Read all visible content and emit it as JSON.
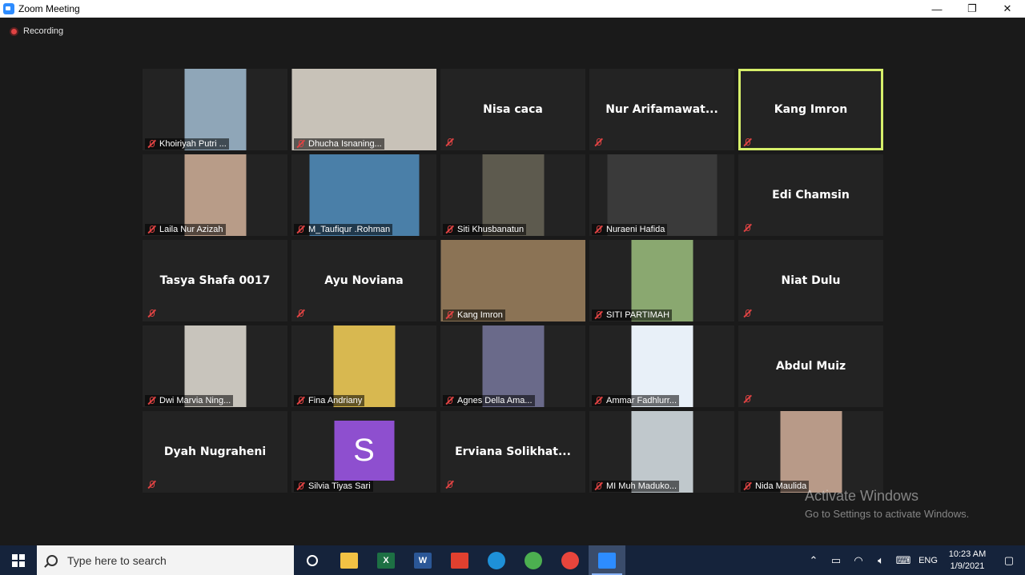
{
  "window": {
    "title": "Zoom Meeting",
    "minimize": "—",
    "maximize": "❐",
    "close": "✕"
  },
  "recording": {
    "label": "Recording"
  },
  "participants": [
    {
      "name": "Khoiriyah Putri ...",
      "video": true,
      "bg": "#8fa6b8"
    },
    {
      "name": "Dhucha Isnaning...",
      "video": true,
      "bg": "#c8c2b8",
      "wide": true
    },
    {
      "name": "Nisa caca",
      "video": false
    },
    {
      "name": "Nur  Arifamawat...",
      "video": false
    },
    {
      "name": "Kang Imron",
      "video": false,
      "active": true
    },
    {
      "name": "Laila Nur Azizah",
      "video": true,
      "bg": "#b89c88"
    },
    {
      "name": "M_Taufiqur .Rohman",
      "video": true,
      "bg": "#4a7fa8",
      "mid": true
    },
    {
      "name": "Siti Khusbanatun",
      "video": true,
      "bg": "#5d5a4e"
    },
    {
      "name": "Nuraeni Hafida",
      "video": true,
      "bg": "#3a3a3a",
      "mid": true
    },
    {
      "name": "Edi Chamsin",
      "video": false
    },
    {
      "name": "Tasya Shafa 0017",
      "video": false
    },
    {
      "name": "Ayu Noviana",
      "video": false
    },
    {
      "name": "Kang Imron",
      "video": true,
      "bg": "#8b7355",
      "wide": true
    },
    {
      "name": "SITI PARTIMAH",
      "video": true,
      "bg": "#8aa870"
    },
    {
      "name": "Niat Dulu",
      "video": false
    },
    {
      "name": "Dwi Marvia Ning...",
      "video": true,
      "bg": "#c8c4bc"
    },
    {
      "name": "Fina Andriany",
      "video": true,
      "bg": "#d8b850"
    },
    {
      "name": "Agnes Della Ama...",
      "video": true,
      "bg": "#6a6a8a"
    },
    {
      "name": "Ammar Fadhlurr...",
      "video": true,
      "bg": "#e8f0f8"
    },
    {
      "name": "Abdul Muiz",
      "video": false
    },
    {
      "name": "Dyah Nugraheni",
      "video": false
    },
    {
      "name": "Silvia Tiyas Sari",
      "video": false,
      "avatar": "S"
    },
    {
      "name": "Erviana  Solikhat...",
      "video": false
    },
    {
      "name": "MI Muh Maduko...",
      "video": true,
      "bg": "#c0c8cc"
    },
    {
      "name": "Nida Maulida",
      "video": true,
      "bg": "#b89a88"
    }
  ],
  "watermark": {
    "title": "Activate Windows",
    "subtitle": "Go to Settings to activate Windows."
  },
  "taskbar": {
    "search_placeholder": "Type here to search",
    "apps": [
      {
        "icon": "file-explorer-icon",
        "color": "#f3c244"
      },
      {
        "icon": "excel-icon",
        "color": "#1d7044",
        "letter": "X"
      },
      {
        "icon": "word-icon",
        "color": "#2b5797",
        "letter": "W"
      },
      {
        "icon": "pdf-reader-icon",
        "color": "#e0402f"
      },
      {
        "icon": "edge-icon",
        "color": "#1e90d8"
      },
      {
        "icon": "chrome-profile-icon",
        "color": "#4caf50"
      },
      {
        "icon": "chrome-icon",
        "color": "#e8453c"
      },
      {
        "icon": "zoom-icon",
        "color": "#2d8cff"
      }
    ],
    "language": "ENG",
    "time": "10:23 AM",
    "date": "1/9/2021"
  }
}
